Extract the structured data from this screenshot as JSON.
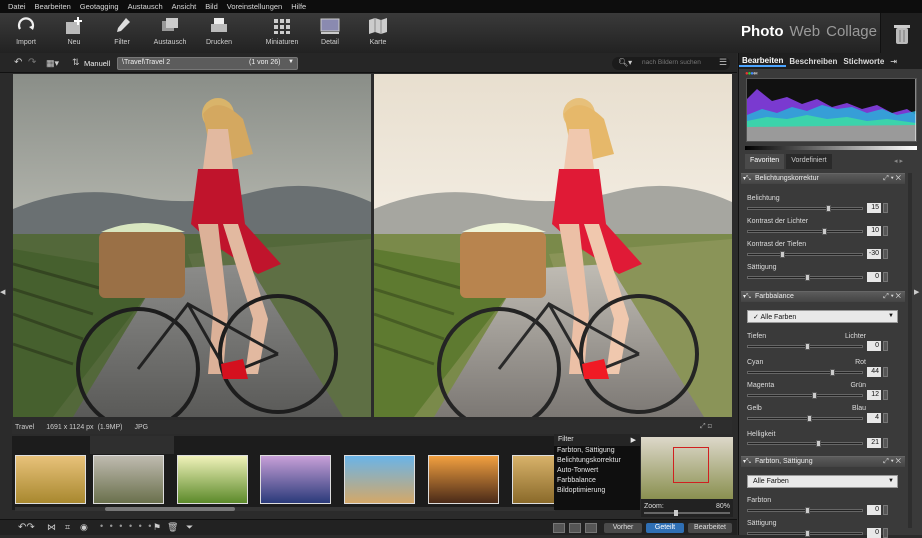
{
  "menu": [
    "Datei",
    "Bearbeiten",
    "Geotagging",
    "Austausch",
    "Ansicht",
    "Bild",
    "Voreinstellungen",
    "Hilfe"
  ],
  "toolbar": {
    "import": "Import",
    "neu": "Neu",
    "filter": "Filter",
    "austausch": "Austausch",
    "drucken": "Drucken",
    "miniaturen": "Miniaturen",
    "detail": "Detail",
    "karte": "Karte"
  },
  "modes": {
    "photo": "Photo",
    "web": "Web",
    "collage": "Collage"
  },
  "subbar": {
    "sort": "Manuell",
    "path": "\\Travel\\Travel 2",
    "count": "(1 von 26)",
    "search_placeholder": "nach Bildern suchen"
  },
  "info": {
    "folder": "Travel",
    "dims": "1691 x 1124 px",
    "mp": "(1.9MP)",
    "format": "JPG"
  },
  "filter_menu": {
    "title": "Filter",
    "items": [
      "Farbton, Sättigung",
      "Belichtungskorrektur",
      "Auto-Tonwert",
      "Farbbalance",
      "Bildoptimierung"
    ]
  },
  "navigator": {
    "zoom_label": "Zoom:",
    "zoom_value": "80%"
  },
  "bottom": {
    "vorher": "Vorher",
    "geteilt": "Geteilt",
    "bearbeitet": "Bearbeitet"
  },
  "right_tabs": [
    "Bearbeiten",
    "Beschreiben",
    "Stichworte"
  ],
  "filter_tabs": [
    "Favoriten",
    "Vordefiniert"
  ],
  "belichtung": {
    "title": "Belichtungskorrektur",
    "rows": [
      {
        "label": "Belichtung",
        "value": "15",
        "pos": 0.68
      },
      {
        "label": "Kontrast der Lichter",
        "value": "10",
        "pos": 0.65
      },
      {
        "label": "Kontrast der Tiefen",
        "value": "-30",
        "pos": 0.28
      },
      {
        "label": "Sättigung",
        "value": "0",
        "pos": 0.5
      }
    ]
  },
  "farbbalance": {
    "title": "Farbbalance",
    "dropdown": "Alle Farben",
    "check": "✓",
    "tiefen": "Tiefen",
    "lichter": "Lichter",
    "tiefen_value": "0",
    "tiefen_pos": 0.5,
    "rows": [
      {
        "left": "Cyan",
        "right": "Rot",
        "value": "44",
        "pos": 0.72
      },
      {
        "left": "Magenta",
        "right": "Grün",
        "value": "12",
        "pos": 0.56
      },
      {
        "left": "Gelb",
        "right": "Blau",
        "value": "4",
        "pos": 0.52
      }
    ],
    "helligkeit": "Helligkeit",
    "helligkeit_value": "21",
    "helligkeit_pos": 0.6
  },
  "farbton": {
    "title": "Farbton, Sättigung",
    "dropdown": "Alle Farben",
    "rows": [
      {
        "label": "Farbton",
        "value": "0",
        "pos": 0.5
      },
      {
        "label": "Sättigung",
        "value": "0",
        "pos": 0.5
      }
    ]
  }
}
